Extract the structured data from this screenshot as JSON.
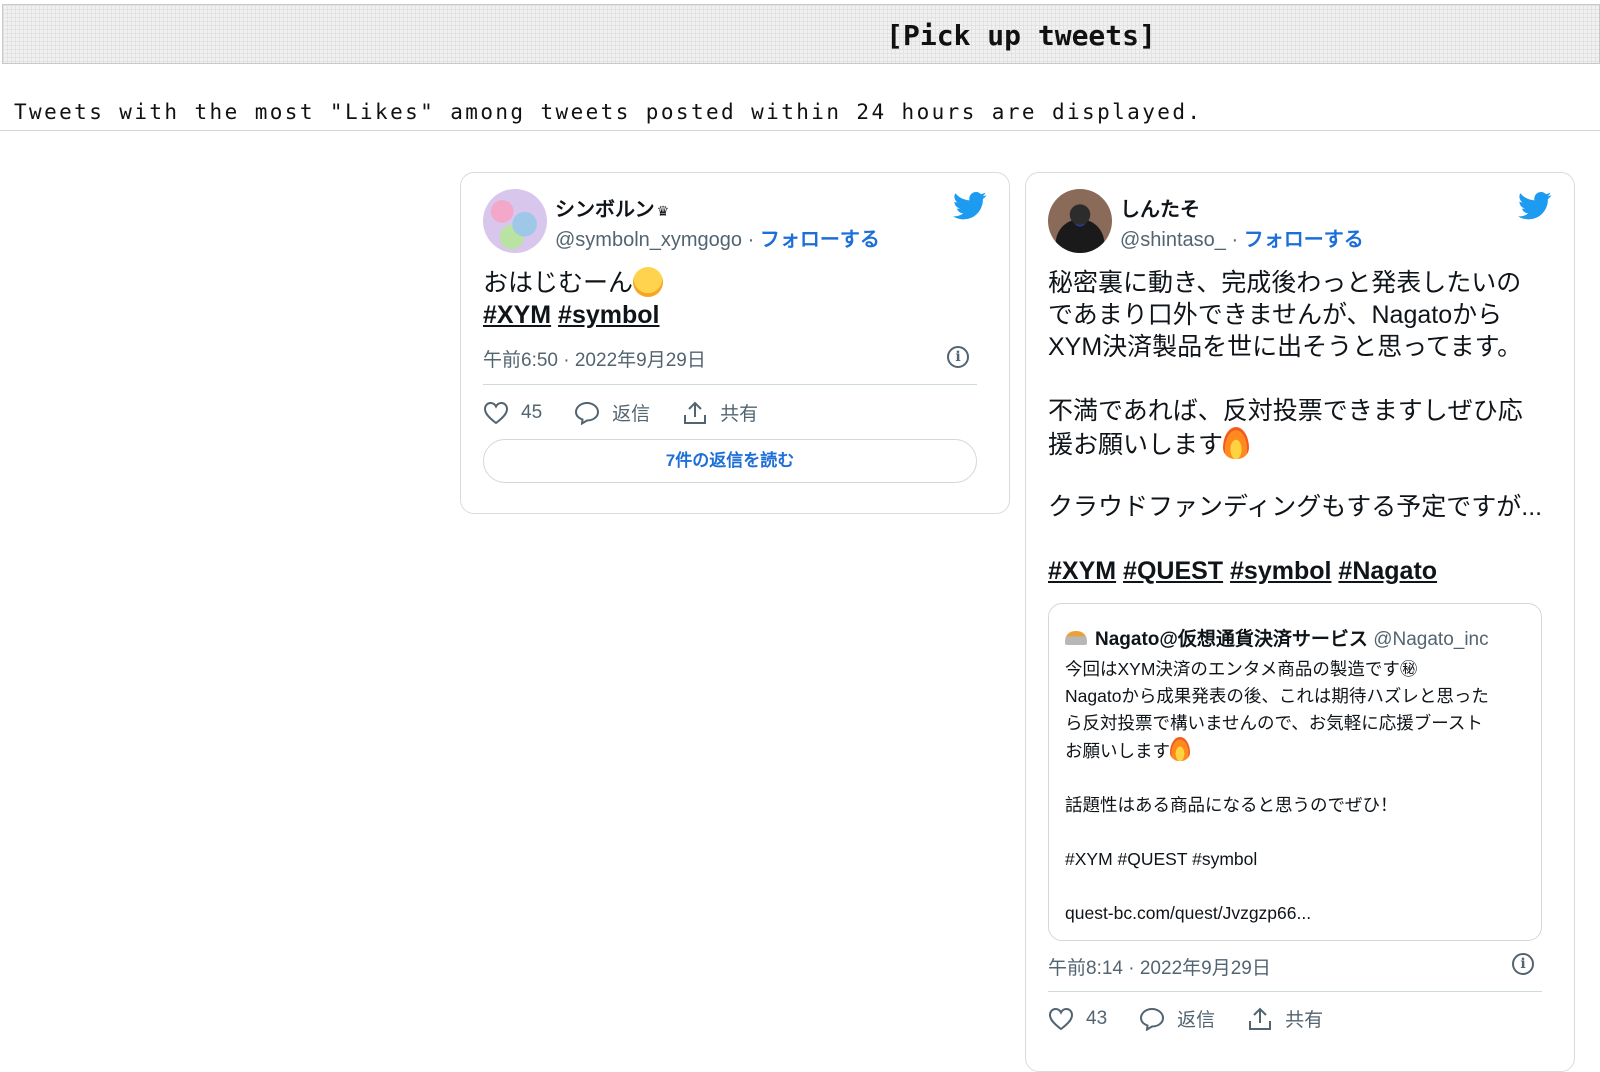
{
  "header": {
    "title": "[Pick up tweets]",
    "subtitle": "Tweets with the most \"Likes\" among tweets posted within 24 hours are displayed."
  },
  "tweets": [
    {
      "display_name": "シンボルン",
      "name_suffix": "♛",
      "handle": "@symboln_xymgogo",
      "separator": "·",
      "follow_label": "フォローする",
      "text_line1": "おはじむーん",
      "hashtags": [
        "#XYM",
        "#symbol"
      ],
      "timestamp": "午前6:50 · 2022年9月29日",
      "likes": "45",
      "reply_label": "返信",
      "share_label": "共有",
      "read_replies_label": "7件の返信を読む"
    },
    {
      "display_name": "しんたそ",
      "handle": "@shintaso_",
      "separator": "·",
      "follow_label": "フォローする",
      "text_lines": [
        "秘密裏に動き、完成後わっと発表したいの",
        "であまり口外できませんが、Nagatoから",
        "XYM決済製品を世に出そうと思ってます。"
      ],
      "text_lines_2": [
        "不満であれば、反対投票できますしぜひ応",
        "援お願いします"
      ],
      "text_line_3": "クラウドファンディングもする予定ですが...",
      "hashtags": [
        "#XYM",
        "#QUEST",
        "#symbol",
        "#Nagato"
      ],
      "quote": {
        "name": "Nagato@仮想通貨決済サービス",
        "handle": "@Nagato_inc",
        "lines": [
          "今回はXYM決済のエンタメ商品の製造です㊙",
          "Nagatoから成果発表の後、これは期待ハズレと思った",
          "ら反対投票で構いませんので、お気軽に応援ブースト",
          "お願いします"
        ],
        "line_2": "話題性はある商品になると思うのでぜひ！",
        "hashtags_line": "#XYM #QUEST #symbol",
        "link": "quest-bc.com/quest/Jvzgzp66..."
      },
      "timestamp": "午前8:14 · 2022年9月29日",
      "likes": "43",
      "reply_label": "返信",
      "share_label": "共有"
    }
  ],
  "colors": {
    "accent_blue": "#1d6fd8",
    "twitter_blue": "#1d9bf0",
    "muted_text": "#536471"
  },
  "icons": {
    "brand": "twitter-bird-icon",
    "like": "heart-icon",
    "reply": "speech-bubble-icon",
    "share": "share-upload-icon",
    "info": "info-icon"
  }
}
